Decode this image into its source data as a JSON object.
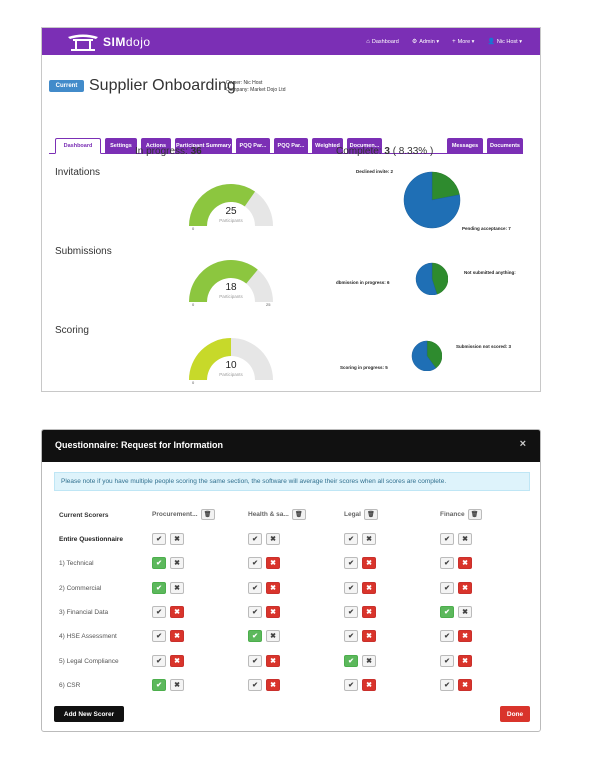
{
  "app": {
    "brand": "SIMdojo",
    "brand_sim": "SIM",
    "brand_dojo": "dojo",
    "nav": [
      {
        "icon": "home-icon",
        "glyph": "⌂",
        "label": "Dashboard"
      },
      {
        "icon": "cogs-icon",
        "glyph": "⚙",
        "label": "Admin ▾"
      },
      {
        "icon": "plus-icon",
        "glyph": "+",
        "label": "More ▾"
      },
      {
        "icon": "user-icon",
        "glyph": "👤",
        "label": "Nic Host ▾"
      }
    ],
    "accent": "#7b2fb5"
  },
  "header": {
    "badge": "Current",
    "title": "Supplier Onboarding",
    "owner": "Owner: Nic Host",
    "company": "Company: Market Dojo Ltd"
  },
  "tabs": [
    {
      "label": "Dashboard",
      "active": true
    },
    {
      "label": "Settings"
    },
    {
      "label": "Actions"
    },
    {
      "label": "Participant Summary"
    },
    {
      "label": "PQQ Par..."
    },
    {
      "label": "PQQ Par..."
    },
    {
      "label": "Weighted"
    },
    {
      "label": "Documen..."
    },
    {
      "label": "Messages"
    },
    {
      "label": "Documents"
    }
  ],
  "dashboard": {
    "in_progress_label": "In progress:",
    "in_progress_value": "36",
    "complete_label": "Complete:",
    "complete_value": "3",
    "complete_pct": "( 8.33% )",
    "sections": [
      {
        "label": "Invitations",
        "gauge": {
          "value": "25",
          "caption": "Participants",
          "min": "0",
          "max": "",
          "fraction": 0.694,
          "color": "#8cc63f"
        },
        "pie": {
          "labels": [
            "Declined invite: 2",
            "Pending acceptance: 7"
          ],
          "fractions": [
            0.22,
            0.78
          ]
        }
      },
      {
        "label": "Submissions",
        "gauge": {
          "value": "18",
          "caption": "Participants",
          "min": "0",
          "max": "25",
          "fraction": 0.72,
          "color": "#8cc63f"
        },
        "pie": {
          "labels": [
            "dbmission in progress: 6",
            "Not submitted anything:"
          ],
          "fractions": [
            0.45,
            0.55
          ]
        }
      },
      {
        "label": "Scoring",
        "gauge": {
          "value": "10",
          "caption": "Participants",
          "min": "0",
          "max": "",
          "fraction": 0.5,
          "color": "#c7d92a"
        },
        "pie": {
          "labels": [
            "Submission not scored: 3",
            "Scoring in progress: 5"
          ],
          "fractions": [
            0.4,
            0.6
          ]
        }
      }
    ]
  },
  "modal": {
    "title": "Questionnaire: Request for Information",
    "close": "×",
    "info": "Please note if you have multiple people scoring the same section, the software will average their scores when all scores are complete.",
    "current_scorers": "Current Scorers",
    "columns": [
      "Procurement...",
      "Health & sa...",
      "Legal",
      "Finance"
    ],
    "rows": [
      {
        "label": "Entire Questionnaire",
        "bold": true,
        "cells": [
          [
            "n",
            "n"
          ],
          [
            "n",
            "n"
          ],
          [
            "n",
            "n"
          ],
          [
            "n",
            "n"
          ]
        ]
      },
      {
        "label": "1) Technical",
        "cells": [
          [
            "g",
            "n"
          ],
          [
            "n",
            "r"
          ],
          [
            "n",
            "r"
          ],
          [
            "n",
            "r"
          ]
        ]
      },
      {
        "label": "2) Commercial",
        "cells": [
          [
            "g",
            "n"
          ],
          [
            "n",
            "r"
          ],
          [
            "n",
            "r"
          ],
          [
            "n",
            "r"
          ]
        ]
      },
      {
        "label": "3) Financial Data",
        "cells": [
          [
            "n",
            "r"
          ],
          [
            "n",
            "r"
          ],
          [
            "n",
            "r"
          ],
          [
            "g",
            "n"
          ]
        ]
      },
      {
        "label": "4) HSE Assessment",
        "cells": [
          [
            "n",
            "r"
          ],
          [
            "g",
            "n"
          ],
          [
            "n",
            "r"
          ],
          [
            "n",
            "r"
          ]
        ]
      },
      {
        "label": "5) Legal Compliance",
        "cells": [
          [
            "n",
            "r"
          ],
          [
            "n",
            "r"
          ],
          [
            "g",
            "n"
          ],
          [
            "n",
            "r"
          ]
        ]
      },
      {
        "label": "6) CSR",
        "cells": [
          [
            "g",
            "n"
          ],
          [
            "n",
            "r"
          ],
          [
            "n",
            "r"
          ],
          [
            "n",
            "r"
          ]
        ]
      }
    ],
    "add_button": "Add New Scorer",
    "done_button": "Done",
    "colors": {
      "green": "#5cb85c",
      "red": "#d9342b"
    }
  }
}
